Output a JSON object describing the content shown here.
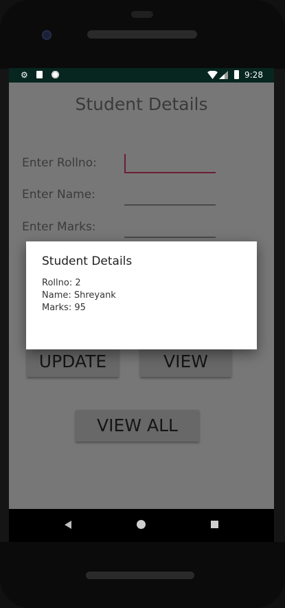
{
  "status_bar": {
    "time": "9:28",
    "left_icons": [
      "gear-icon",
      "sd-card-icon",
      "circle-icon"
    ],
    "right_icons": [
      "wifi-icon",
      "signal-icon",
      "battery-icon"
    ]
  },
  "app": {
    "title": "Student Details",
    "fields": [
      {
        "label": "Enter Rollno:",
        "value": ""
      },
      {
        "label": "Enter Name:",
        "value": ""
      },
      {
        "label": "Enter Marks:",
        "value": ""
      }
    ],
    "buttons": {
      "update": "UPDATE",
      "view": "VIEW",
      "view_all": "VIEW ALL"
    }
  },
  "dialog": {
    "title": "Student Details",
    "lines": [
      "Rollno: 2",
      "Name: Shreyank",
      "Marks: 95"
    ]
  },
  "nav_bar": {
    "icons": [
      "back-icon",
      "home-icon",
      "recents-icon"
    ]
  },
  "colors": {
    "status_bar_bg": "#07261f",
    "screen_dim_bg": "#777777",
    "cursor_accent": "#6b1e34",
    "dialog_bg": "#ffffff"
  }
}
